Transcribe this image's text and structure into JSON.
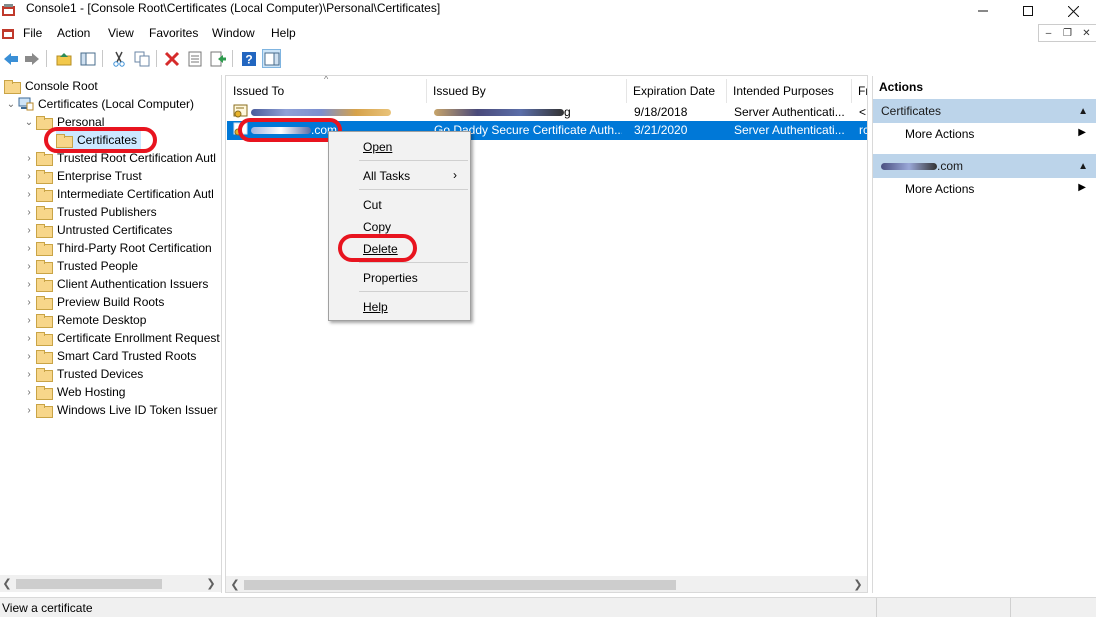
{
  "window": {
    "title": "Console1 - [Console Root\\Certificates (Local Computer)\\Personal\\Certificates]"
  },
  "menu": [
    "File",
    "Action",
    "View",
    "Favorites",
    "Window",
    "Help"
  ],
  "toolbar_icons": [
    "back-icon",
    "forward-icon",
    "up-folder-icon",
    "show-hide-tree-icon",
    "cut-icon",
    "copy-icon",
    "delete-icon",
    "properties-icon",
    "export-icon",
    "help-icon",
    "show-hide-action-pane-icon"
  ],
  "tree": {
    "root": "Console Root",
    "computer": "Certificates (Local Computer)",
    "personal": "Personal",
    "certificates": "Certificates",
    "stores": [
      "Trusted Root Certification Autl",
      "Enterprise Trust",
      "Intermediate Certification Autl",
      "Trusted Publishers",
      "Untrusted Certificates",
      "Third-Party Root Certification",
      "Trusted People",
      "Client Authentication Issuers",
      "Preview Build Roots",
      "Remote Desktop",
      "Certificate Enrollment Request",
      "Smart Card Trusted Roots",
      "Trusted Devices",
      "Web Hosting",
      "Windows Live ID Token Issuer"
    ]
  },
  "list": {
    "columns": [
      "Issued To",
      "Issued By",
      "Expiration Date",
      "Intended Purposes",
      "Fr"
    ],
    "rows": [
      {
        "issued_to": "",
        "issued_by": "g",
        "expiration": "9/18/2018",
        "purposes": "Server Authenticati...",
        "friendly": "<"
      },
      {
        "issued_to": ".com",
        "issued_by": "Go Daddy Secure Certificate Auth...",
        "expiration": "3/21/2020",
        "purposes": "Server Authenticati...",
        "friendly": "rc"
      }
    ]
  },
  "context_menu": {
    "open": "Open",
    "all_tasks": "All Tasks",
    "cut": "Cut",
    "copy": "Copy",
    "delete": "Delete",
    "properties": "Properties",
    "help": "Help"
  },
  "actions": {
    "title": "Actions",
    "section1": "Certificates",
    "section1_item": "More Actions",
    "section2": ".com",
    "section2_item": "More Actions"
  },
  "status": {
    "text": "View a certificate"
  },
  "colors": {
    "selection": "#0078d7",
    "highlight_ring": "#e8141f",
    "action_header": "#bcd4ea"
  }
}
